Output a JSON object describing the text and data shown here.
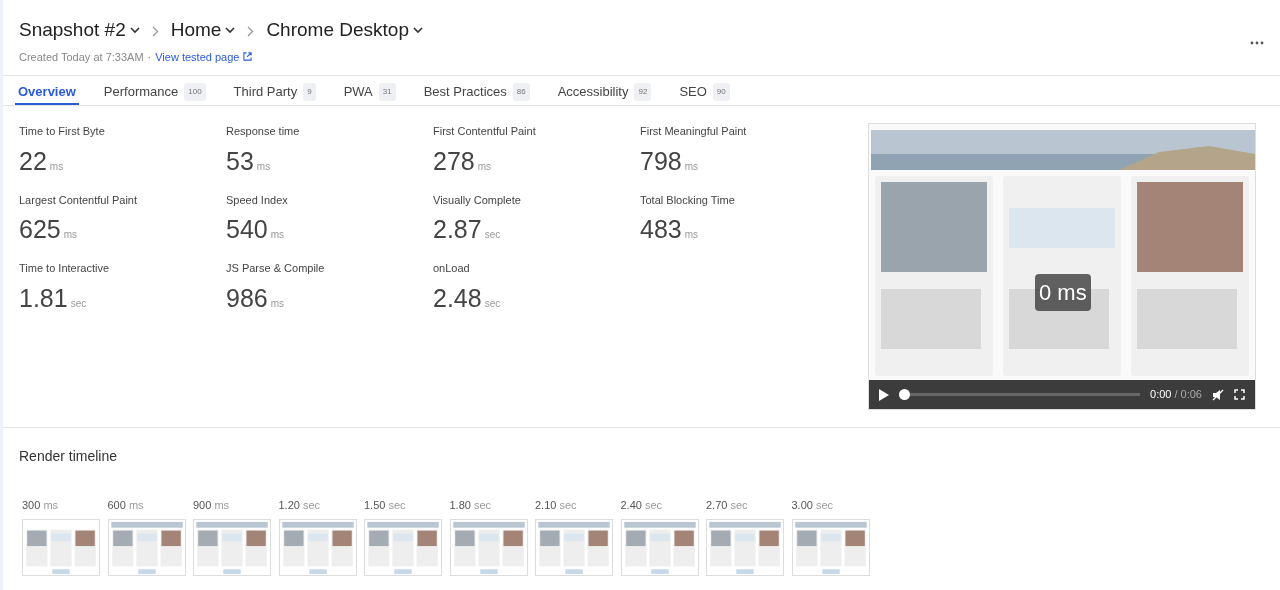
{
  "breadcrumbs": [
    {
      "label": "Snapshot #2"
    },
    {
      "label": "Home"
    },
    {
      "label": "Chrome Desktop"
    }
  ],
  "created": "Created Today at 7:33AM",
  "separator": "·",
  "link": "View tested page",
  "tabs": [
    {
      "label": "Overview",
      "selected": true
    },
    {
      "label": "Performance",
      "badge": "100",
      "selected": false
    },
    {
      "label": "Third Party",
      "badge": "9",
      "selected": false
    },
    {
      "label": "PWA",
      "badge": "31",
      "selected": false
    },
    {
      "label": "Best Practices",
      "badge": "86",
      "selected": false
    },
    {
      "label": "Accessibility",
      "badge": "92",
      "selected": false
    },
    {
      "label": "SEO",
      "badge": "90",
      "selected": false
    }
  ],
  "metrics": [
    {
      "label": "Time to First Byte",
      "value": "22",
      "unit": "ms"
    },
    {
      "label": "Response time",
      "value": "53",
      "unit": "ms"
    },
    {
      "label": "First Contentful Paint",
      "value": "278",
      "unit": "ms"
    },
    {
      "label": "First Meaningful Paint",
      "value": "798",
      "unit": "ms"
    },
    {
      "label": "Largest Contentful Paint",
      "value": "625",
      "unit": "ms"
    },
    {
      "label": "Speed Index",
      "value": "540",
      "unit": "ms"
    },
    {
      "label": "Visually Complete",
      "value": "2.87",
      "unit": "sec"
    },
    {
      "label": "Total Blocking Time",
      "value": "483",
      "unit": "ms"
    },
    {
      "label": "Time to Interactive",
      "value": "1.81",
      "unit": "sec"
    },
    {
      "label": "JS Parse & Compile",
      "value": "986",
      "unit": "ms"
    },
    {
      "label": "onLoad",
      "value": "2.48",
      "unit": "sec"
    }
  ],
  "video": {
    "overlay": "0 ms",
    "progress": {
      "level": 0
    },
    "current": "0:00",
    "duration": "/ 0:06"
  },
  "render_timeline": {
    "title": "Render timeline",
    "frames": [
      {
        "time": "300",
        "unit": "ms"
      },
      {
        "time": "600",
        "unit": "ms"
      },
      {
        "time": "900",
        "unit": "ms"
      },
      {
        "time": "1.20",
        "unit": "sec"
      },
      {
        "time": "1.50",
        "unit": "sec"
      },
      {
        "time": "1.80",
        "unit": "sec"
      },
      {
        "time": "2.10",
        "unit": "sec"
      },
      {
        "time": "2.40",
        "unit": "sec"
      },
      {
        "time": "2.70",
        "unit": "sec"
      },
      {
        "time": "3.00",
        "unit": "sec"
      }
    ]
  }
}
